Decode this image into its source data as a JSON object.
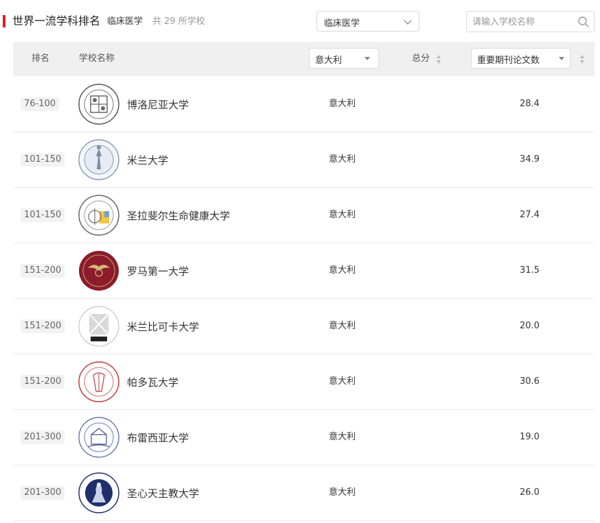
{
  "header": {
    "title": "世界一流学科排名",
    "subject": "临床医学",
    "count_prefix": "共",
    "count_value": "29",
    "count_suffix": "所学校",
    "subject_select_value": "临床医学",
    "search_placeholder": "请输入学校名称"
  },
  "table": {
    "col_rank": "排名",
    "col_name": "学校名称",
    "country_filter": "意大利",
    "col_total": "总分",
    "indicator_select": "重要期刊论文数"
  },
  "rows": [
    {
      "rank": "76-100",
      "name": "博洛尼亚大学",
      "country": "意大利",
      "score": "28.4"
    },
    {
      "rank": "101-150",
      "name": "米兰大学",
      "country": "意大利",
      "score": "34.9"
    },
    {
      "rank": "101-150",
      "name": "圣拉斐尔生命健康大学",
      "country": "意大利",
      "score": "27.4"
    },
    {
      "rank": "151-200",
      "name": "罗马第一大学",
      "country": "意大利",
      "score": "31.5"
    },
    {
      "rank": "151-200",
      "name": "米兰比可卡大学",
      "country": "意大利",
      "score": "20.0"
    },
    {
      "rank": "151-200",
      "name": "帕多瓦大学",
      "country": "意大利",
      "score": "30.6"
    },
    {
      "rank": "201-300",
      "name": "布雷西亚大学",
      "country": "意大利",
      "score": "19.0"
    },
    {
      "rank": "201-300",
      "name": "圣心天主教大学",
      "country": "意大利",
      "score": "26.0"
    }
  ],
  "colors": {
    "accent": "#e02020",
    "header_bg": "#f0f0f0",
    "badge_bg": "#f2f2f2"
  }
}
